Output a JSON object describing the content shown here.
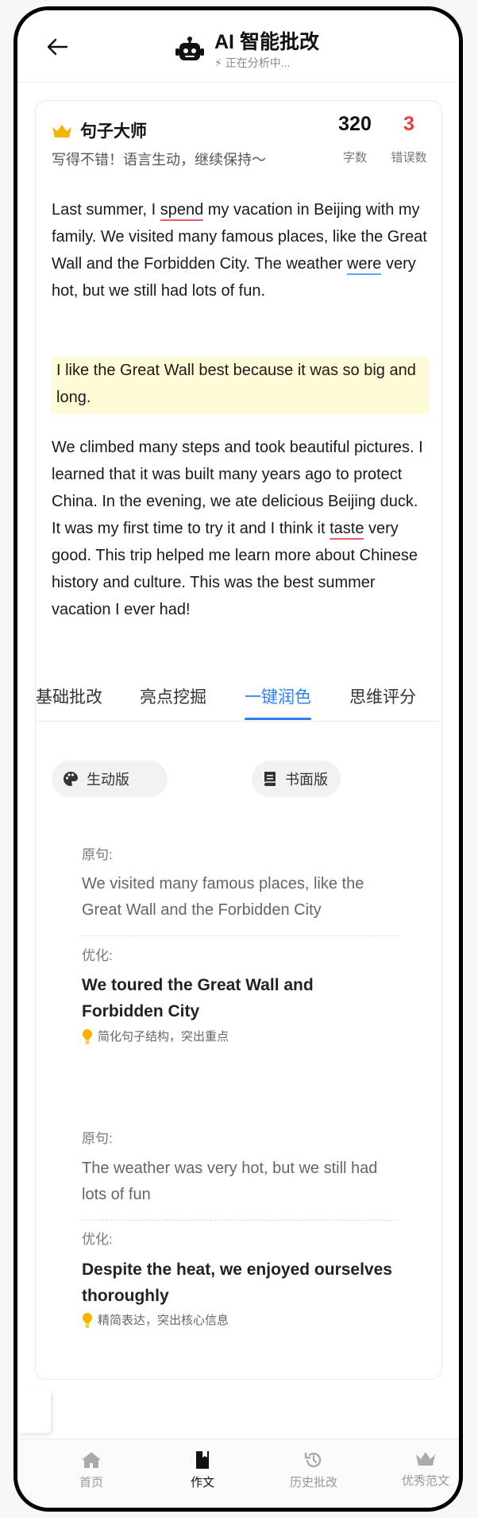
{
  "header": {
    "title": "AI 智能批改",
    "status": "⚡ 正在分析中..."
  },
  "summary": {
    "grade": "句子大师",
    "comment": "写得不错！语言生动，继续保持～",
    "word_count": "320",
    "word_count_label": "字数",
    "error_count": "3",
    "error_count_label": "错误数"
  },
  "essay": {
    "p1_a": "Last summer, I ",
    "p1_err1": "spend",
    "p1_b": " my vacation in Beijing with my family. We visited many famous places, like the Great Wall and the Forbidden City. The weather ",
    "p1_err2": "were",
    "p1_c": " very hot, but we still had lots of fun.",
    "highlight": "I like the Great Wall best because it was so big and long.",
    "p3_a": "We climbed many steps and took beautiful pictures. I learned that it was built many years ago to protect China. In the evening, we ate delicious Beijing duck. It was my first time to try it and I think it ",
    "p3_err": "taste",
    "p3_b": " very good. This trip helped me learn more about Chinese history and culture. This was the best summer vacation I ever had!"
  },
  "tabs": [
    "基础批改",
    "亮点挖掘",
    "一键润色",
    "思维评分"
  ],
  "active_tab": "一键润色",
  "styles": {
    "vivid": "生动版",
    "formal": "书面版"
  },
  "suggestions": [
    {
      "orig_label": "原句:",
      "original": "We visited many famous places, like the Great Wall and the Forbidden City",
      "opt_label": "优化:",
      "optimized": "We toured the Great Wall and Forbidden City",
      "tip": "简化句子结构，突出重点"
    },
    {
      "orig_label": "原句:",
      "original": "The weather was very hot, but we still had lots of fun",
      "opt_label": "优化:",
      "optimized": "Despite the heat, we enjoyed ourselves thoroughly",
      "tip": "精简表达，突出核心信息"
    }
  ],
  "nav": {
    "home": "首页",
    "essay": "作文",
    "history": "历史批改",
    "excellent": "优秀范文"
  },
  "colors": {
    "accent": "#2f80ed",
    "error_red": "#e53e3e",
    "highlight_bg": "#fefbd6",
    "crown": "#f5b400"
  }
}
